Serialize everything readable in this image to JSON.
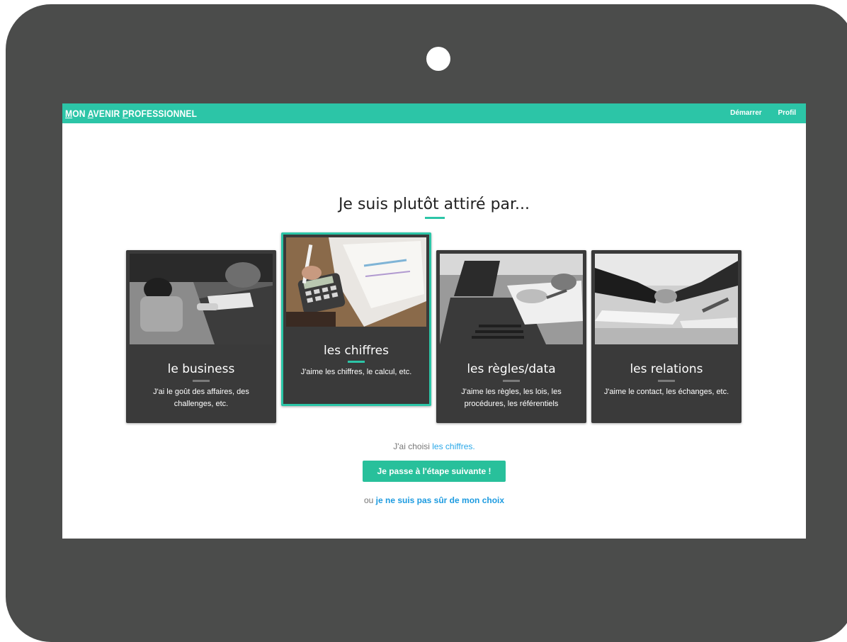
{
  "navbar": {
    "brand": [
      {
        "cap": "M",
        "rest": "ON "
      },
      {
        "cap": "A",
        "rest": "VENIR "
      },
      {
        "cap": "P",
        "rest": "ROFESSIONNEL"
      }
    ],
    "links": [
      "Démarrer",
      "Profil"
    ]
  },
  "heading": "Je suis plutôt attiré par...",
  "cards": [
    {
      "title": "le business",
      "description": "J'ai le goût des affaires, des challenges, etc.",
      "selected": false,
      "photo_icon": "business-meeting-photo"
    },
    {
      "title": "les chiffres",
      "description": "J'aime les chiffres, le calcul, etc.",
      "selected": true,
      "photo_icon": "calculator-photo"
    },
    {
      "title": "les règles/data",
      "description": "J'aime les règles, les lois, les procédures, les référentiels",
      "selected": false,
      "photo_icon": "laptop-documents-photo"
    },
    {
      "title": "les relations",
      "description": "J'aime le contact, les échanges, etc.",
      "selected": false,
      "photo_icon": "handshake-photo"
    }
  ],
  "choice": {
    "prefix": "J'ai choisi ",
    "selected": "les chiffres."
  },
  "next_button": "Je passe à l'étape suivante !",
  "unsure": {
    "prefix": "ou ",
    "link": "je ne suis pas sûr de mon choix"
  },
  "colors": {
    "accent": "#2cc5a7",
    "button": "#28c09b",
    "link": "#1d9be0",
    "card_bg": "#3a3a3a",
    "frame": "#4b4c4b"
  }
}
